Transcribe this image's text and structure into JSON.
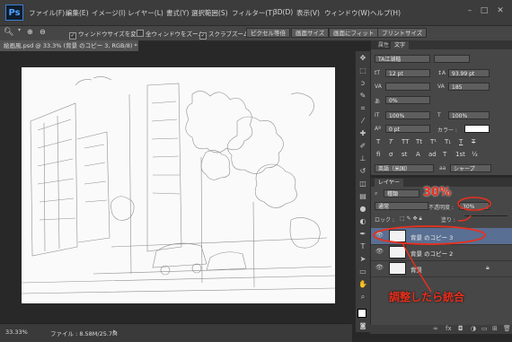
{
  "app": {
    "logo": "Ps"
  },
  "menu": {
    "items": [
      "ファイル(F)",
      "編集(E)",
      "イメージ(I)",
      "レイヤー(L)",
      "書式(Y)",
      "選択範囲(S)",
      "フィルター(T)",
      "3D(D)",
      "表示(V)",
      "ウィンドウ(W)",
      "ヘルプ(H)"
    ]
  },
  "options": {
    "resize_windows": "ウィンドウサイズを変更",
    "all_windows_zoom": "全ウィンドウをズーム",
    "scrubby_zoom": "スクラブズーム",
    "actual_pixels": "ピクセル等倍",
    "fit_screen": "画面サイズ",
    "fill_screen": "画面にフィット",
    "print_size": "プリントサイズ"
  },
  "document": {
    "tab_title": "絵画風.psd @ 33.3% (背景 のコピー 3, RGB/8) *",
    "zoom": "33.33%",
    "file_info": "ファイル : 8.58M/25.7M"
  },
  "character_panel": {
    "tabs": [
      "属性",
      "文字"
    ],
    "font_family": "TA江湖楷",
    "font_size": "12 pt",
    "leading": "93.99 pt",
    "tracking": "185",
    "vertical_scale": "100%",
    "horizontal_scale": "100%",
    "baseline_shift": "0 pt",
    "color_label": "カラー :",
    "tsume": "0%",
    "type_buttons": [
      "T",
      "T",
      "TT",
      "Tt",
      "T¹",
      "T₁",
      "T",
      "T"
    ],
    "extra_buttons": [
      "fi",
      "σ",
      "st",
      "A",
      "ad",
      "T",
      "1st",
      "½"
    ],
    "language": "英語（米国）",
    "aa_label": "aa",
    "antialias": "シャープ"
  },
  "layers_panel": {
    "tab": "レイヤー",
    "filter_kind": "種類",
    "blend_mode": "通常",
    "opacity_label": "不透明度 :",
    "opacity_value": "30%",
    "lock_label": "ロック :",
    "fill_label": "塗り :",
    "layers": [
      {
        "name": "背景 のコピー 3",
        "selected": true
      },
      {
        "name": "背景 のコピー 2",
        "selected": false
      },
      {
        "name": "背景",
        "selected": false
      }
    ]
  },
  "annotations": {
    "opacity_callout": "30%",
    "merge_callout": "調整したら統合"
  },
  "colors": {
    "accent_red": "#e8301e",
    "selected_layer": "#596f93"
  }
}
